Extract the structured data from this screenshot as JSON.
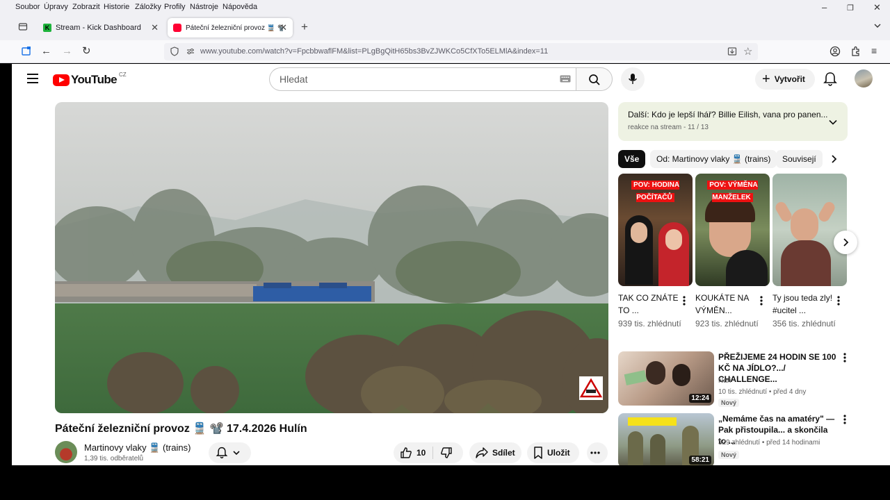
{
  "menubar": {
    "items": [
      "Soubor",
      "Úpravy",
      "Zobrazit",
      "Historie",
      "Záložky",
      "Profily",
      "Nástroje",
      "Nápověda"
    ]
  },
  "tabs": [
    {
      "title": "Stream - Kick Dashboard",
      "favicon_color": "#1db33b"
    },
    {
      "title": "Páteční železniční provoz 🚆 📽️",
      "favicon_color": "#ff0033"
    }
  ],
  "url": "www.youtube.com/watch?v=FpcbbwaflFM&list=PLgBgQitH65bs3BvZJWKCo5CfXTo5ELMlA&index=11",
  "youtube": {
    "country": "CZ",
    "search_placeholder": "Hledat",
    "create_label": "Vytvořit"
  },
  "video": {
    "title": "Páteční železniční provoz 🚆 📽️ 17.4.2026 Hulín",
    "channel": "Martinovy vlaky 🚆 (trains)",
    "subscribers": "1,39 tis. odběratelů",
    "likes": "10",
    "share_label": "Sdílet",
    "save_label": "Uložit"
  },
  "playlist_next": {
    "title": "Další: Kdo je lepší lhář? Billie Eilish, vana pro panen...",
    "subtitle": "reakce na stream - 11 / 13"
  },
  "chips": [
    "Vše",
    "Od: Martinovy vlaky 🚆 (trains)",
    "Souvisejí"
  ],
  "shorts": [
    {
      "overlay": "POV: HODINA POČÍTAČŮ",
      "title": "TAK CO ZNÁTE TO ...",
      "views": "939 tis. zhlédnutí"
    },
    {
      "overlay": "POV: VÝMĚNA MANŽELEK",
      "title": "KOUKÁTE NA VÝMĚN...",
      "views": "923 tis. zhlédnutí"
    },
    {
      "overlay": "",
      "title": "Ty jsou teda zly! #ucitel ...",
      "views": "356 tis. zhlédnutí"
    }
  ],
  "recommendations": [
    {
      "title": "PŘEŽIJEME 24 HODIN SE 100 KČ NA JÍDLO?.../ CHALLENGE...",
      "channel": "Nari",
      "meta": "10 tis. zhlédnutí • před 4 dny",
      "badge": "Nový",
      "duration": "12:24"
    },
    {
      "title": "„Nemáme čas na amatéry\" — Pak přistoupila... a skončila to ...",
      "channel": "",
      "meta": "329 zhlédnutí • před 14 hodinami",
      "badge": "Nový",
      "duration": "58:21"
    }
  ]
}
